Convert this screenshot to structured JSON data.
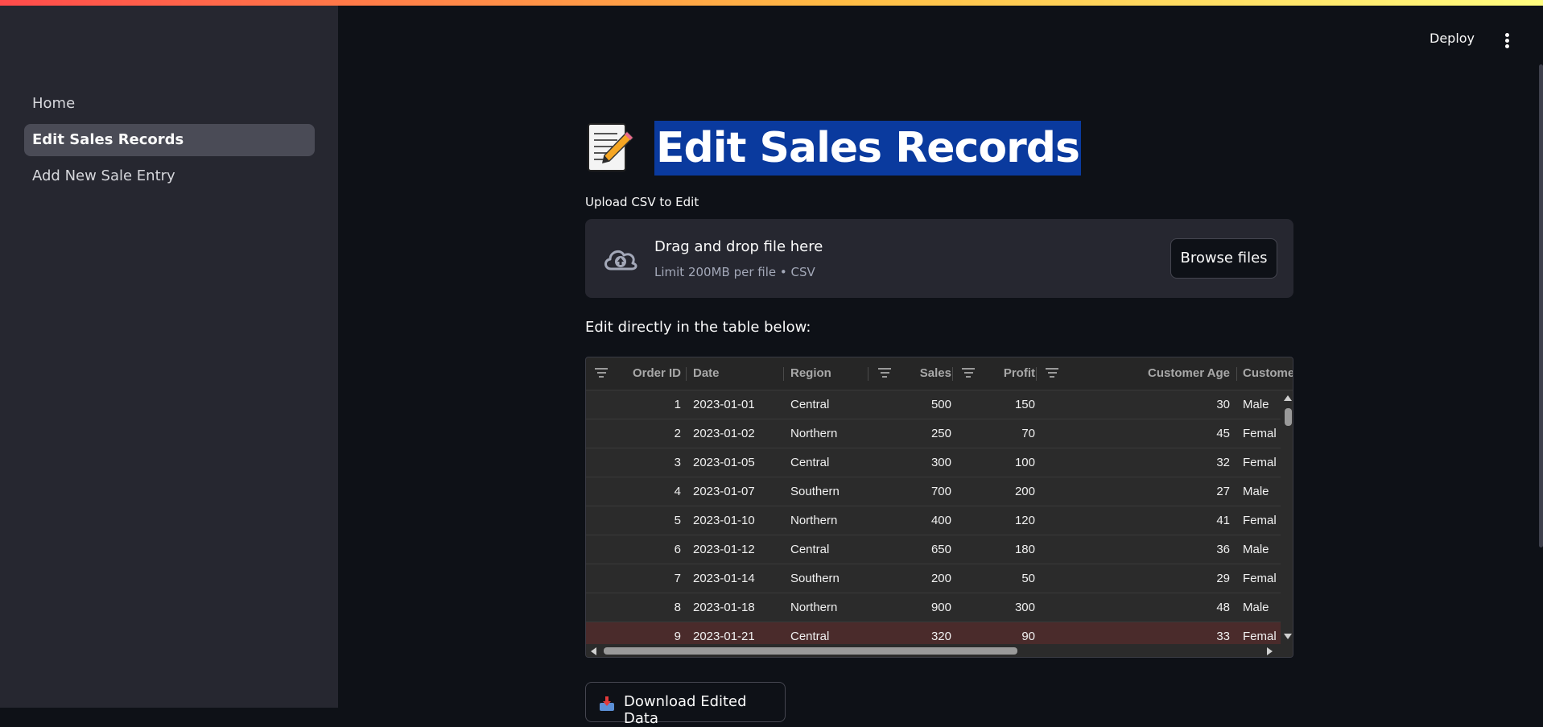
{
  "sidebar": {
    "items": [
      {
        "label": "Home",
        "active": false
      },
      {
        "label": "Edit Sales Records",
        "active": true
      },
      {
        "label": "Add New Sale Entry",
        "active": false
      }
    ]
  },
  "header": {
    "deploy_label": "Deploy",
    "menu_icon": "kebab-menu-icon"
  },
  "page": {
    "title_icon": "memo-icon",
    "title": "Edit Sales Records",
    "upload_label": "Upload CSV to Edit",
    "dropzone": {
      "icon": "cloud-upload-icon",
      "main_text": "Drag and drop file here",
      "sub_text": "Limit 200MB per file • CSV",
      "browse_label": "Browse files"
    },
    "edit_note": "Edit directly in the table below:",
    "download_label": "Download Edited Data",
    "download_icon": "inbox-tray-icon"
  },
  "table": {
    "headers": [
      "Order ID",
      "Date",
      "Region",
      "Sales",
      "Profit",
      "Customer Age",
      "Custome"
    ],
    "rows": [
      [
        "1",
        "2023-01-01",
        "Central",
        "500",
        "150",
        "30",
        "Male"
      ],
      [
        "2",
        "2023-01-02",
        "Northern",
        "250",
        "70",
        "45",
        "Femal"
      ],
      [
        "3",
        "2023-01-05",
        "Central",
        "300",
        "100",
        "32",
        "Femal"
      ],
      [
        "4",
        "2023-01-07",
        "Southern",
        "700",
        "200",
        "27",
        "Male"
      ],
      [
        "5",
        "2023-01-10",
        "Northern",
        "400",
        "120",
        "41",
        "Femal"
      ],
      [
        "6",
        "2023-01-12",
        "Central",
        "650",
        "180",
        "36",
        "Male"
      ],
      [
        "7",
        "2023-01-14",
        "Southern",
        "200",
        "50",
        "29",
        "Femal"
      ],
      [
        "8",
        "2023-01-18",
        "Northern",
        "900",
        "300",
        "48",
        "Male"
      ],
      [
        "9",
        "2023-01-21",
        "Central",
        "320",
        "90",
        "33",
        "Femal"
      ]
    ],
    "selected_row": 8
  },
  "colors": {
    "accent_top": "#ff4b4b",
    "sidebar_bg": "#262730",
    "main_bg": "#0e1117",
    "title_highlight": "#0a3a9e"
  }
}
